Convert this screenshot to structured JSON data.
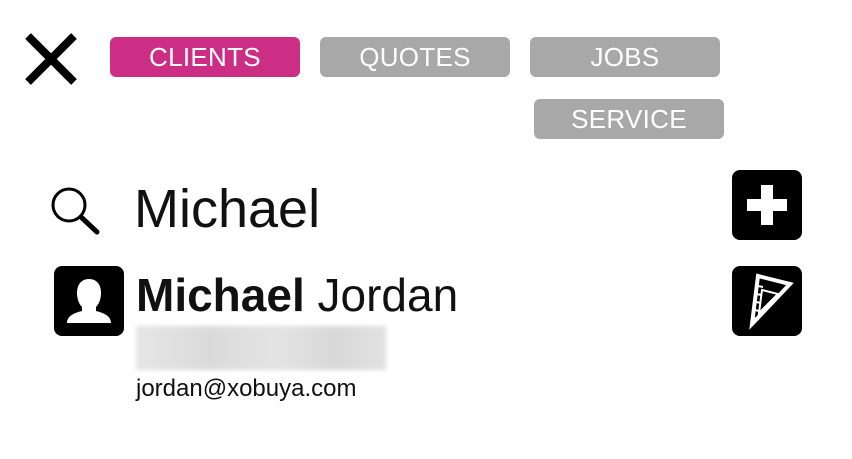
{
  "nav": {
    "close_icon": "close-x-icon",
    "tabs": [
      {
        "label": "CLIENTS",
        "active": true,
        "color": "#cc2e86"
      },
      {
        "label": "QUOTES",
        "active": false,
        "color": "#a8a8a9"
      },
      {
        "label": "JOBS",
        "active": false,
        "color": "#a8a8a9"
      },
      {
        "label": "SERVICE",
        "active": false,
        "color": "#a8a8a9"
      }
    ]
  },
  "search": {
    "icon": "search-icon",
    "value": "Michael",
    "placeholder": ""
  },
  "actions": {
    "add_icon": "plus-icon",
    "quote_icon": "triangle-ruler-icon"
  },
  "results": [
    {
      "first_name": "Michael",
      "last_name": "Jordan",
      "phone": "",
      "email": "jordan@xobuya.com",
      "avatar_icon": "person-silhouette-icon"
    }
  ],
  "colors": {
    "accent": "#cc2e86",
    "tab_inactive": "#a8a8a9",
    "icon_tile": "#000000"
  }
}
